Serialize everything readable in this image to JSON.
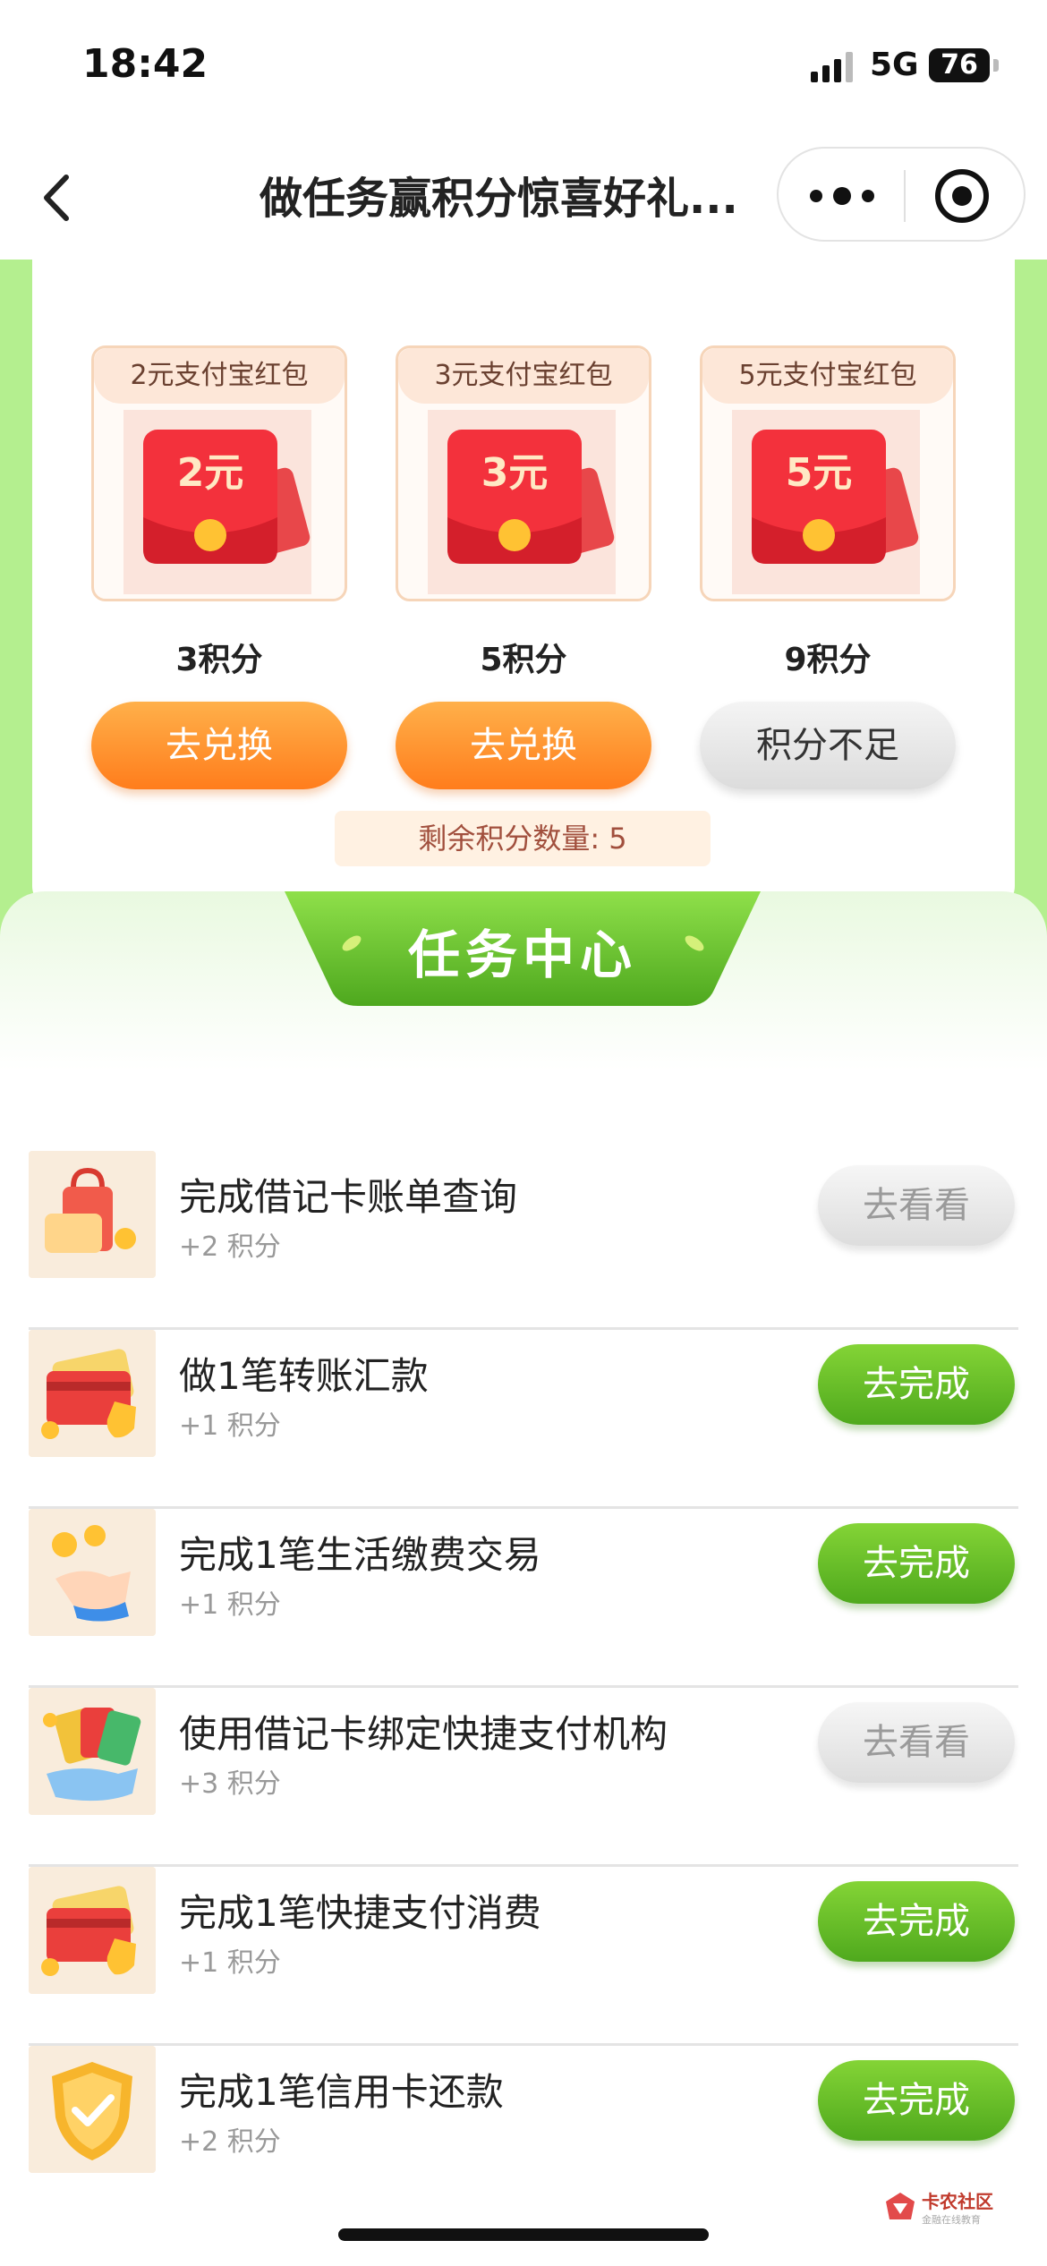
{
  "status_bar": {
    "time": "18:42",
    "network": "5G",
    "battery": "76"
  },
  "nav": {
    "title": "做任务赢积分惊喜好礼..."
  },
  "prizes": [
    {
      "tag": "2元支付宝红包",
      "amount": "2元",
      "points": "3积分",
      "button": "去兑换",
      "enabled": true
    },
    {
      "tag": "3元支付宝红包",
      "amount": "3元",
      "points": "5积分",
      "button": "去兑换",
      "enabled": true
    },
    {
      "tag": "5元支付宝红包",
      "amount": "5元",
      "points": "9积分",
      "button": "积分不足",
      "enabled": false
    }
  ],
  "remaining_points": "剩余积分数量: 5",
  "task_center": {
    "title": "任务中心",
    "tasks": [
      {
        "name": "完成借记卡账单查询",
        "points": "+2 积分",
        "button": "去看看",
        "style": "gray"
      },
      {
        "name": "做1笔转账汇款",
        "points": "+1 积分",
        "button": "去完成",
        "style": "green"
      },
      {
        "name": "完成1笔生活缴费交易",
        "points": "+1 积分",
        "button": "去完成",
        "style": "green"
      },
      {
        "name": "使用借记卡绑定快捷支付机构",
        "points": "+3 积分",
        "button": "去看看",
        "style": "gray"
      },
      {
        "name": "完成1笔快捷支付消费",
        "points": "+1 积分",
        "button": "去完成",
        "style": "green"
      },
      {
        "name": "完成1笔信用卡还款",
        "points": "+2 积分",
        "button": "去完成",
        "style": "green"
      }
    ]
  },
  "watermark": {
    "text": "卡农社区",
    "subtext": "金融在线教育"
  },
  "colors": {
    "green_bg": "#b4ef8f",
    "orange": "#ff8a24",
    "green_btn": "#5cb425",
    "remain_text": "#a14f3d"
  }
}
